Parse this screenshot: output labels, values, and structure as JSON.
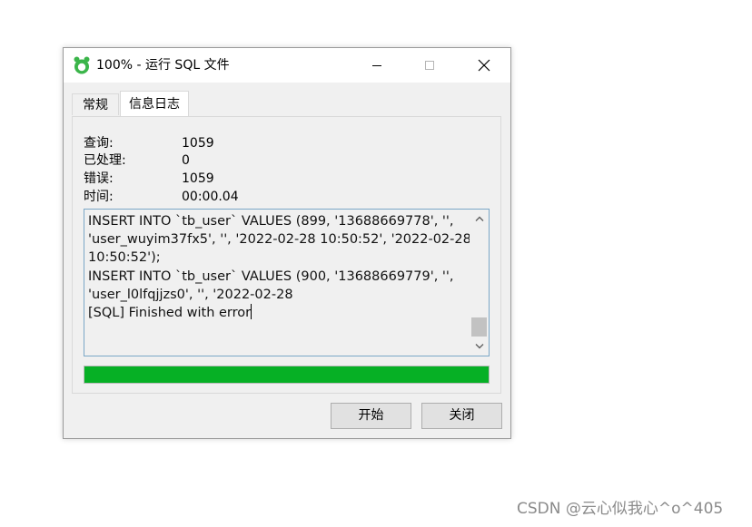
{
  "window": {
    "title": "100% - 运行 SQL 文件",
    "icon": "navicat-logo-icon",
    "controls": [
      "minimize-icon",
      "maximize-icon",
      "close-icon"
    ]
  },
  "tabs": [
    {
      "label": "常规",
      "active": false
    },
    {
      "label": "信息日志",
      "active": true
    }
  ],
  "stats": {
    "queries_label": "查询:",
    "queries_value": "1059",
    "processed_label": "已处理:",
    "processed_value": "0",
    "errors_label": "错误:",
    "errors_value": "1059",
    "time_label": "时间:",
    "time_value": "00:00.04"
  },
  "log": {
    "lines": [
      "INSERT INTO `tb_user` VALUES (899, '13688669778', '',",
      "'user_wuyim37fx5', '', '2022-02-28 10:50:52', '2022-02-28",
      "10:50:52');",
      "INSERT INTO `tb_user` VALUES (900, '13688669779', '',",
      "'user_l0lfqjjzs0', '', '2022-02-28",
      "[SQL] Finished with error"
    ]
  },
  "progress": {
    "percent": 100,
    "color": "#06b025"
  },
  "buttons": {
    "start_label": "开始",
    "close_label": "关闭"
  },
  "watermark": "CSDN @云心似我心^o^405"
}
